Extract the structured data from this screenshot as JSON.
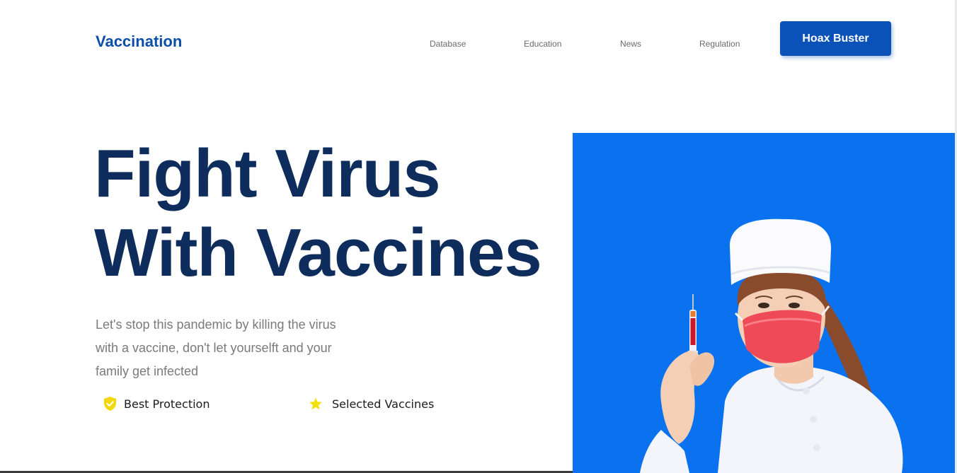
{
  "header": {
    "logo": "Vaccination",
    "nav": [
      "Database",
      "Education",
      "News",
      "Regulation"
    ],
    "cta_label": "Hoax Buster"
  },
  "hero": {
    "title_line1": "Fight Virus",
    "title_line2": "With Vaccines",
    "desc_line1": "Let's stop this pandemic by killing the virus",
    "desc_line2": "with a vaccine, don't let yourselft and your",
    "desc_line3": "family get infected",
    "features": [
      {
        "label": "Best Protection",
        "icon": "shield-check-icon",
        "icon_color": "#f2d90b"
      },
      {
        "label": "Selected Vaccines",
        "icon": "star-icon",
        "icon_color": "#f2e20b"
      }
    ]
  },
  "colors": {
    "brand": "#0b4fa8",
    "button": "#0b52b8",
    "title": "#0f2d5c",
    "panel": "#0a72ee",
    "mask": "#ef4a57"
  }
}
